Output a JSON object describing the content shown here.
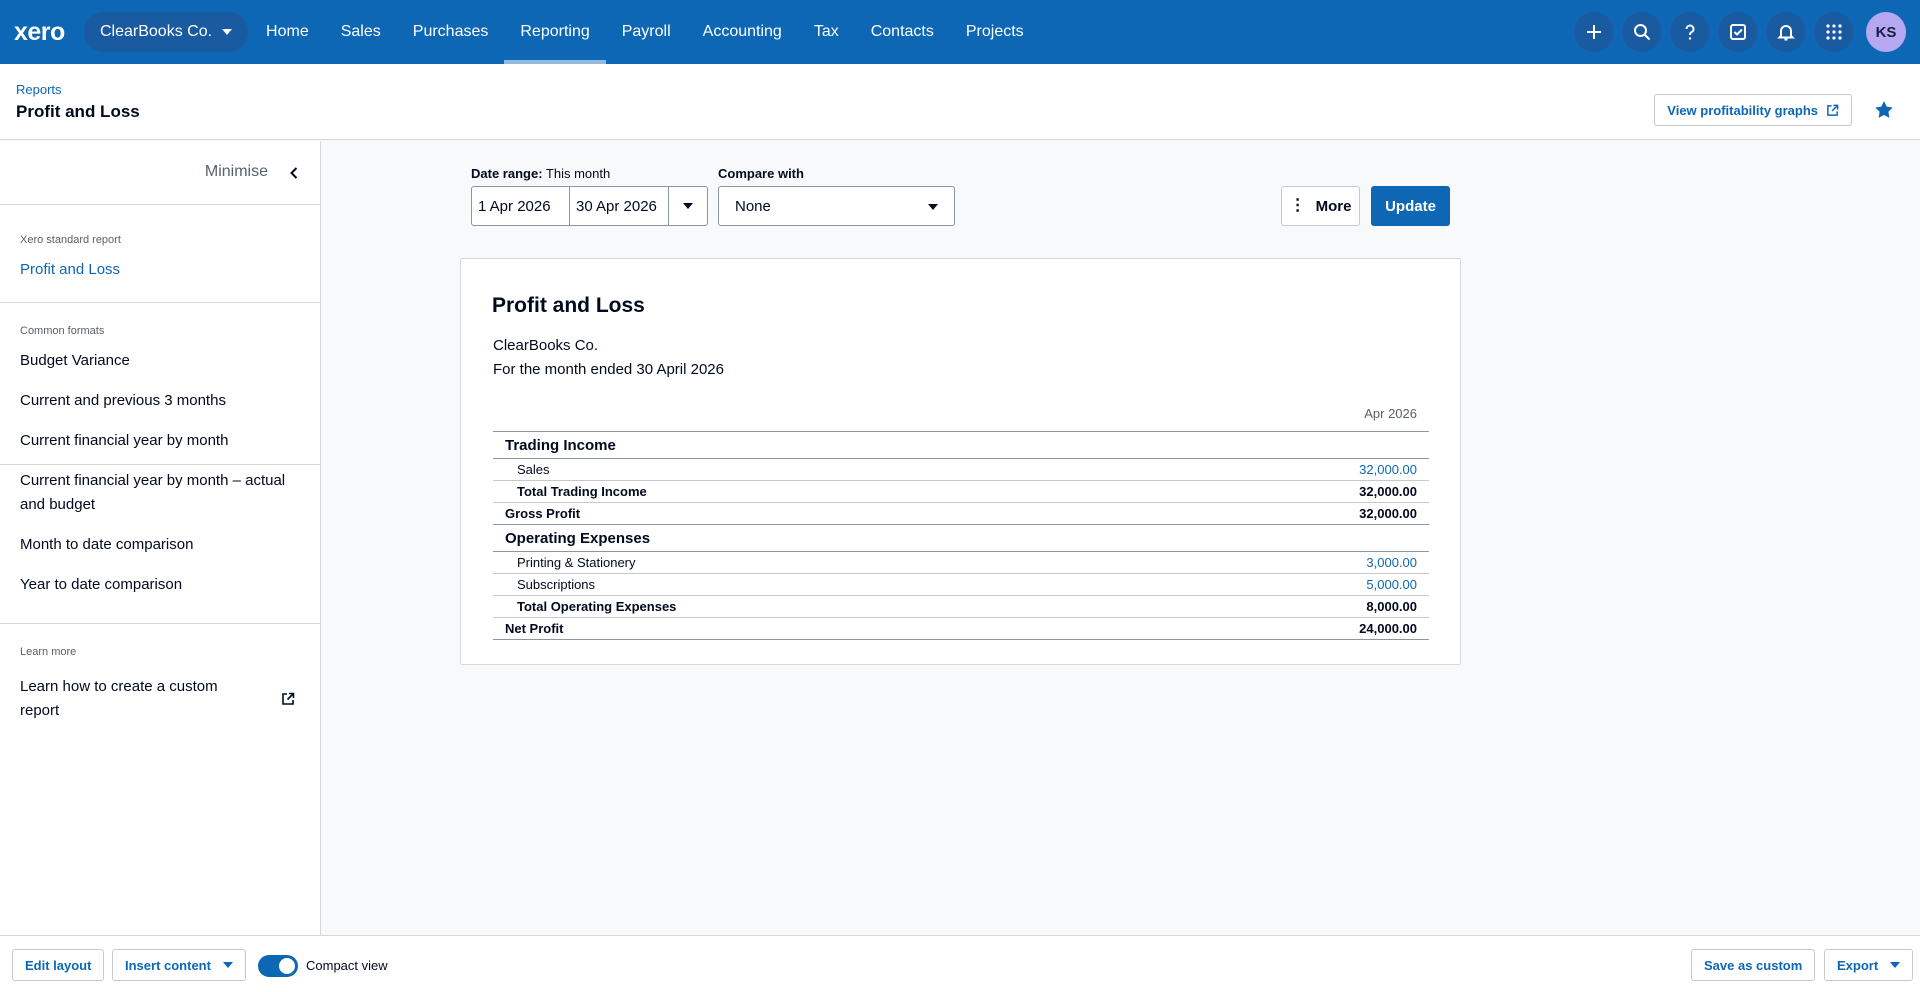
{
  "nav": {
    "logo": "xero",
    "org": "ClearBooks Co.",
    "items": [
      "Home",
      "Sales",
      "Purchases",
      "Reporting",
      "Payroll",
      "Accounting",
      "Tax",
      "Contacts",
      "Projects"
    ],
    "active": "Reporting",
    "icons": [
      "plus-icon",
      "search-icon",
      "help-icon",
      "tasks-icon",
      "bell-icon",
      "apps-icon"
    ],
    "avatar": "KS"
  },
  "header": {
    "breadcrumb": "Reports",
    "title": "Profit and Loss",
    "graphs_button": "View profitability graphs"
  },
  "sidebar": {
    "minimise": "Minimise",
    "standard_heading": "Xero standard report",
    "standard_item": "Profit and Loss",
    "formats_heading": "Common formats",
    "formats": [
      "Budget Variance",
      "Current and previous 3 months",
      "Current financial year by month",
      "Current financial year by month – actual and budget",
      "Month to date comparison",
      "Year to date comparison"
    ],
    "learn_heading": "Learn more",
    "learn_link": "Learn how to create a custom report"
  },
  "controls": {
    "date_range_label": "Date range:",
    "date_range_value": "This month",
    "from": "1 Apr 2026",
    "to": "30 Apr 2026",
    "compare_label": "Compare with",
    "compare_value": "None",
    "more": "More",
    "update": "Update"
  },
  "report": {
    "title": "Profit and Loss",
    "org": "ClearBooks Co.",
    "period": "For the month ended 30 April 2026",
    "column": "Apr 2026",
    "rows": [
      {
        "type": "section",
        "label": "Trading Income",
        "amount": ""
      },
      {
        "type": "item",
        "label": "Sales",
        "amount": "32,000.00"
      },
      {
        "type": "total-indent",
        "label": "Total Trading Income",
        "amount": "32,000.00"
      },
      {
        "type": "total",
        "label": "Gross Profit",
        "amount": "32,000.00"
      },
      {
        "type": "section",
        "label": "Operating Expenses",
        "amount": ""
      },
      {
        "type": "item",
        "label": "Printing & Stationery",
        "amount": "3,000.00"
      },
      {
        "type": "item",
        "label": "Subscriptions",
        "amount": "5,000.00"
      },
      {
        "type": "total-indent",
        "label": "Total Operating Expenses",
        "amount": "8,000.00"
      },
      {
        "type": "total",
        "label": "Net Profit",
        "amount": "24,000.00"
      }
    ]
  },
  "bottom": {
    "edit_layout": "Edit layout",
    "insert_content": "Insert content",
    "compact_view": "Compact view",
    "compact_on": true,
    "save_custom": "Save as custom",
    "export": "Export"
  },
  "colors": {
    "brand": "#0d67b5",
    "text": "#000a1e",
    "muted": "#58616a"
  }
}
